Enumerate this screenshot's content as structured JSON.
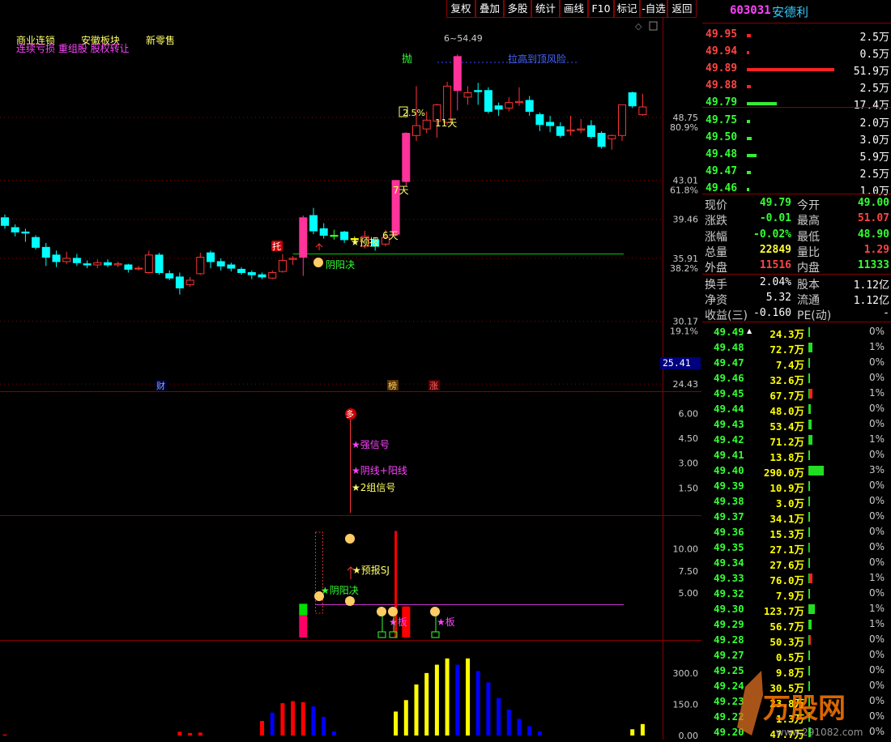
{
  "toolbar": {
    "buttons": [
      "复权",
      "叠加",
      "多股",
      "统计",
      "画线",
      "F10",
      "标记",
      "-自选",
      "返回"
    ]
  },
  "header": {
    "code": "603031",
    "name": "安德利"
  },
  "chart_tags": {
    "line1": [
      "商业连锁",
      "安徽板块",
      "新零售"
    ],
    "line2": "连续亏损 重组股 股权转让"
  },
  "price_axis": {
    "labels": [
      {
        "v": "48.75",
        "p": "80.9%"
      },
      {
        "v": "43.01",
        "p": "61.8%"
      },
      {
        "v": "39.46",
        "p": ""
      },
      {
        "v": "35.91",
        "p": "38.2%"
      },
      {
        "v": "30.17",
        "p": "19.1%"
      },
      {
        "v": "24.43",
        "p": ""
      }
    ],
    "current_box": "25.41"
  },
  "main_annotations": {
    "high": "6~54.49",
    "sell": "抛",
    "risk": "拉高到顶风险",
    "pct": "2.5%",
    "days11": "11天",
    "days7": "7天",
    "days6": "6天",
    "tuo": "托",
    "forecast": "★预报",
    "yinyang": "阴阳决",
    "cai": "财",
    "bang": "榜",
    "zhang": "涨"
  },
  "panel2": {
    "axis": [
      "6.00",
      "4.50",
      "3.00",
      "1.50"
    ],
    "duo": "多",
    "signals": [
      "★强信号",
      "★阴线+阳线",
      "★2组信号"
    ]
  },
  "panel3": {
    "axis": [
      "10.00",
      "7.50",
      "5.00"
    ],
    "labels": [
      "★预报SJ",
      "★阴阳决",
      "★板",
      "★板"
    ]
  },
  "panel4": {
    "axis": [
      "300.0",
      "150.0",
      "0.00"
    ]
  },
  "order_book": {
    "asks": [
      {
        "price": "49.95",
        "vol": "2.5万",
        "bar": 0.05
      },
      {
        "price": "49.94",
        "vol": "0.5万",
        "bar": 0.01
      },
      {
        "price": "49.89",
        "vol": "51.9万",
        "bar": 1.0
      },
      {
        "price": "49.88",
        "vol": "2.5万",
        "bar": 0.05
      },
      {
        "price": "49.79",
        "vol": "17.4万",
        "bar": 0.34
      }
    ],
    "bids": [
      {
        "price": "49.75",
        "vol": "2.0万",
        "bar": 0.04
      },
      {
        "price": "49.50",
        "vol": "3.0万",
        "bar": 0.06
      },
      {
        "price": "49.48",
        "vol": "5.9万",
        "bar": 0.11
      },
      {
        "price": "49.47",
        "vol": "2.5万",
        "bar": 0.05
      },
      {
        "price": "49.46",
        "vol": "1.0万",
        "bar": 0.02
      }
    ]
  },
  "stats": [
    {
      "l1": "现价",
      "v1": "49.79",
      "c1": "#33ff33",
      "l2": "今开",
      "v2": "49.00",
      "c2": "#33ff33"
    },
    {
      "l1": "涨跌",
      "v1": "-0.01",
      "c1": "#33ff33",
      "l2": "最高",
      "v2": "51.07",
      "c2": "#ff4444"
    },
    {
      "l1": "涨幅",
      "v1": "-0.02%",
      "c1": "#33ff33",
      "l2": "最低",
      "v2": "48.90",
      "c2": "#33ff33"
    },
    {
      "l1": "总量",
      "v1": "22849",
      "c1": "#ffff33",
      "l2": "量比",
      "v2": "1.29",
      "c2": "#ff4444"
    },
    {
      "l1": "外盘",
      "v1": "11516",
      "c1": "#ff4444",
      "l2": "内盘",
      "v2": "11333",
      "c2": "#33ff33"
    }
  ],
  "fundamentals": [
    {
      "l1": "换手",
      "v1": "2.04%",
      "l2": "股本",
      "v2": "1.12亿"
    },
    {
      "l1": "净资",
      "v1": "5.32",
      "l2": "流通",
      "v2": "1.12亿"
    },
    {
      "l1": "收益(三)",
      "v1": "-0.160",
      "l2": "PE(动)",
      "v2": "-"
    }
  ],
  "price_volume": [
    {
      "price": "49.49",
      "vol": "24.3万",
      "pct": "0%",
      "bar": 0.02,
      "col": "g",
      "arrow": true
    },
    {
      "price": "49.48",
      "vol": "72.7万",
      "pct": "1%",
      "bar": 0.06,
      "col": "g"
    },
    {
      "price": "49.47",
      "vol": "7.4万",
      "pct": "0%",
      "bar": 0.01,
      "col": "g"
    },
    {
      "price": "49.46",
      "vol": "32.6万",
      "pct": "0%",
      "bar": 0.03,
      "col": "g"
    },
    {
      "price": "49.45",
      "vol": "67.7万",
      "pct": "1%",
      "bar": 0.06,
      "col": "r"
    },
    {
      "price": "49.44",
      "vol": "48.0万",
      "pct": "0%",
      "bar": 0.04,
      "col": "g"
    },
    {
      "price": "49.43",
      "vol": "53.4万",
      "pct": "0%",
      "bar": 0.05,
      "col": "g"
    },
    {
      "price": "49.42",
      "vol": "71.2万",
      "pct": "1%",
      "bar": 0.06,
      "col": "g"
    },
    {
      "price": "49.41",
      "vol": "13.8万",
      "pct": "0%",
      "bar": 0.01,
      "col": "g"
    },
    {
      "price": "49.40",
      "vol": "290.0万",
      "pct": "3%",
      "bar": 0.24,
      "col": "g"
    },
    {
      "price": "49.39",
      "vol": "10.9万",
      "pct": "0%",
      "bar": 0.01,
      "col": "g"
    },
    {
      "price": "49.38",
      "vol": "3.0万",
      "pct": "0%",
      "bar": 0.0,
      "col": "g"
    },
    {
      "price": "49.37",
      "vol": "34.1万",
      "pct": "0%",
      "bar": 0.03,
      "col": "g"
    },
    {
      "price": "49.36",
      "vol": "15.3万",
      "pct": "0%",
      "bar": 0.01,
      "col": "g"
    },
    {
      "price": "49.35",
      "vol": "27.1万",
      "pct": "0%",
      "bar": 0.02,
      "col": "r"
    },
    {
      "price": "49.34",
      "vol": "27.6万",
      "pct": "0%",
      "bar": 0.02,
      "col": "g"
    },
    {
      "price": "49.33",
      "vol": "76.0万",
      "pct": "1%",
      "bar": 0.06,
      "col": "r"
    },
    {
      "price": "49.32",
      "vol": "7.9万",
      "pct": "0%",
      "bar": 0.01,
      "col": "g"
    },
    {
      "price": "49.30",
      "vol": "123.7万",
      "pct": "1%",
      "bar": 0.1,
      "col": "g"
    },
    {
      "price": "49.29",
      "vol": "56.7万",
      "pct": "1%",
      "bar": 0.05,
      "col": "g"
    },
    {
      "price": "49.28",
      "vol": "50.3万",
      "pct": "0%",
      "bar": 0.04,
      "col": "r"
    },
    {
      "price": "49.27",
      "vol": "0.5万",
      "pct": "0%",
      "bar": 0.0,
      "col": "g"
    },
    {
      "price": "49.25",
      "vol": "9.8万",
      "pct": "0%",
      "bar": 0.01,
      "col": "g"
    },
    {
      "price": "49.24",
      "vol": "30.5万",
      "pct": "0%",
      "bar": 0.03,
      "col": "g"
    },
    {
      "price": "49.23",
      "vol": "23.8万",
      "pct": "0%",
      "bar": 0.02,
      "col": "g"
    },
    {
      "price": "49.22",
      "vol": "1.3万",
      "pct": "0%",
      "bar": 0.0,
      "col": "g"
    },
    {
      "price": "49.20",
      "vol": "47.7万",
      "pct": "0%",
      "bar": 0.04,
      "col": "g"
    }
  ],
  "watermark": {
    "text": "万股网",
    "url": "www.291082.com"
  },
  "chart_data": {
    "type": "candlestick",
    "candles": [
      {
        "o": 39.6,
        "c": 38.9,
        "h": 39.9,
        "l": 38.6
      },
      {
        "o": 38.7,
        "c": 38.3,
        "h": 39.0,
        "l": 37.9
      },
      {
        "o": 38.3,
        "c": 38.2,
        "h": 38.6,
        "l": 37.4
      },
      {
        "o": 37.8,
        "c": 36.9,
        "h": 38.0,
        "l": 36.7
      },
      {
        "o": 36.9,
        "c": 36.0,
        "h": 37.3,
        "l": 35.2
      },
      {
        "o": 36.2,
        "c": 35.6,
        "h": 36.6,
        "l": 35.1
      },
      {
        "o": 35.6,
        "c": 35.9,
        "h": 36.5,
        "l": 35.4
      },
      {
        "o": 35.9,
        "c": 35.5,
        "h": 36.3,
        "l": 35.2
      },
      {
        "o": 35.4,
        "c": 35.3,
        "h": 35.7,
        "l": 35.0
      },
      {
        "o": 35.3,
        "c": 35.5,
        "h": 35.8,
        "l": 35.0
      },
      {
        "o": 35.5,
        "c": 35.3,
        "h": 35.8,
        "l": 35.1
      },
      {
        "o": 35.3,
        "c": 35.4,
        "h": 35.6,
        "l": 35.1
      },
      {
        "o": 35.3,
        "c": 34.9,
        "h": 35.4,
        "l": 34.6
      },
      {
        "o": 35.0,
        "c": 35.0,
        "h": 35.2,
        "l": 34.8
      },
      {
        "o": 34.6,
        "c": 36.2,
        "h": 36.6,
        "l": 34.5
      },
      {
        "o": 36.2,
        "c": 34.6,
        "h": 36.4,
        "l": 34.4
      },
      {
        "o": 34.5,
        "c": 34.1,
        "h": 34.8,
        "l": 33.9
      },
      {
        "o": 34.2,
        "c": 33.2,
        "h": 34.6,
        "l": 32.6
      },
      {
        "o": 33.5,
        "c": 33.9,
        "h": 34.2,
        "l": 33.3
      },
      {
        "o": 34.5,
        "c": 36.0,
        "h": 36.4,
        "l": 34.4
      },
      {
        "o": 36.4,
        "c": 35.6,
        "h": 36.6,
        "l": 35.0
      },
      {
        "o": 35.6,
        "c": 35.2,
        "h": 35.9,
        "l": 34.8
      },
      {
        "o": 35.3,
        "c": 35.0,
        "h": 35.5,
        "l": 34.7
      },
      {
        "o": 34.9,
        "c": 34.6,
        "h": 35.1,
        "l": 34.4
      },
      {
        "o": 34.6,
        "c": 34.4,
        "h": 34.8,
        "l": 34.0
      },
      {
        "o": 34.4,
        "c": 34.2,
        "h": 34.6,
        "l": 34.0
      },
      {
        "o": 34.1,
        "c": 34.6,
        "h": 34.8,
        "l": 34.0
      },
      {
        "o": 34.7,
        "c": 35.7,
        "h": 36.3,
        "l": 34.6
      },
      {
        "o": 35.8,
        "c": 35.9,
        "h": 36.1,
        "l": 35.3
      },
      {
        "o": 36.0,
        "c": 39.6,
        "h": 39.8,
        "l": 34.3
      },
      {
        "o": 39.8,
        "c": 38.4,
        "h": 40.5,
        "l": 38.1
      },
      {
        "o": 38.6,
        "c": 38.0,
        "h": 39.1,
        "l": 37.7
      },
      {
        "o": 38.0,
        "c": 37.9,
        "h": 38.5,
        "l": 37.6
      },
      {
        "o": 38.3,
        "c": 37.6,
        "h": 38.4,
        "l": 37.3
      },
      {
        "o": 37.7,
        "c": 37.6,
        "h": 37.9,
        "l": 37.3
      },
      {
        "o": 37.0,
        "c": 37.9,
        "h": 38.4,
        "l": 36.8
      },
      {
        "o": 37.6,
        "c": 37.0,
        "h": 37.8,
        "l": 36.6
      },
      {
        "o": 37.2,
        "c": 37.8,
        "h": 38.5,
        "l": 37.0
      },
      {
        "o": 38.1,
        "c": 43.0,
        "h": 43.0,
        "l": 37.9
      },
      {
        "o": 42.9,
        "c": 47.3,
        "h": 47.4,
        "l": 42.5
      },
      {
        "o": 47.1,
        "c": 48.0,
        "h": 51.6,
        "l": 46.6
      },
      {
        "o": 47.7,
        "c": 48.5,
        "h": 49.3,
        "l": 47.3
      },
      {
        "o": 48.4,
        "c": 49.9,
        "h": 50.0,
        "l": 46.9
      },
      {
        "o": 48.3,
        "c": 51.6,
        "h": 52.0,
        "l": 48.1
      },
      {
        "o": 51.2,
        "c": 54.3,
        "h": 54.5,
        "l": 49.4
      },
      {
        "o": 50.6,
        "c": 51.0,
        "h": 51.6,
        "l": 49.9
      },
      {
        "o": 51.2,
        "c": 51.1,
        "h": 51.9,
        "l": 49.9
      },
      {
        "o": 51.2,
        "c": 49.3,
        "h": 51.5,
        "l": 49.1
      },
      {
        "o": 49.8,
        "c": 49.5,
        "h": 50.1,
        "l": 48.9
      },
      {
        "o": 49.6,
        "c": 50.1,
        "h": 50.6,
        "l": 49.3
      },
      {
        "o": 50.1,
        "c": 50.2,
        "h": 51.5,
        "l": 49.8
      },
      {
        "o": 50.3,
        "c": 49.3,
        "h": 50.7,
        "l": 48.9
      },
      {
        "o": 49.0,
        "c": 48.1,
        "h": 49.2,
        "l": 47.5
      },
      {
        "o": 48.3,
        "c": 48.0,
        "h": 48.9,
        "l": 47.4
      },
      {
        "o": 47.9,
        "c": 47.1,
        "h": 48.3,
        "l": 46.9
      },
      {
        "o": 47.5,
        "c": 47.6,
        "h": 48.9,
        "l": 47.1
      },
      {
        "o": 47.6,
        "c": 47.7,
        "h": 48.6,
        "l": 47.3
      },
      {
        "o": 48.0,
        "c": 47.0,
        "h": 48.5,
        "l": 46.8
      },
      {
        "o": 47.3,
        "c": 46.1,
        "h": 47.5,
        "l": 45.9
      },
      {
        "o": 46.8,
        "c": 47.1,
        "h": 47.2,
        "l": 45.8
      },
      {
        "o": 47.1,
        "c": 49.9,
        "h": 49.9,
        "l": 46.6
      },
      {
        "o": 51.0,
        "c": 49.8,
        "h": 51.1,
        "l": 49.6
      },
      {
        "o": 49.0,
        "c": 49.7,
        "h": 50.9,
        "l": 48.9
      }
    ],
    "ylim": [
      24.0,
      56.5
    ],
    "support_line": 36.3,
    "mid_volume": [
      {
        "i": 29,
        "v": 2.5,
        "col": "#ff0066"
      },
      {
        "i": 29,
        "v": 1.3,
        "col": "#00e000"
      },
      {
        "i": 38,
        "v": 12.0,
        "col": "#ff0000"
      },
      {
        "i": 39,
        "v": 3.5,
        "col": "#ff0000"
      }
    ],
    "bottom_volume": [
      {
        "i": 0,
        "v": 5,
        "col": "#ff0000"
      },
      {
        "i": 17,
        "v": 18,
        "col": "#ff0000"
      },
      {
        "i": 18,
        "v": 12,
        "col": "#ff0000"
      },
      {
        "i": 19,
        "v": 14,
        "col": "#ff0000"
      },
      {
        "i": 25,
        "v": 70,
        "col": "#ff0000"
      },
      {
        "i": 26,
        "v": 110,
        "col": "#0000ff"
      },
      {
        "i": 27,
        "v": 155,
        "col": "#ff0000"
      },
      {
        "i": 28,
        "v": 165,
        "col": "#ff0000"
      },
      {
        "i": 29,
        "v": 160,
        "col": "#ff0000"
      },
      {
        "i": 30,
        "v": 140,
        "col": "#0000ff"
      },
      {
        "i": 31,
        "v": 90,
        "col": "#0000ff"
      },
      {
        "i": 32,
        "v": 20,
        "col": "#0000ff"
      },
      {
        "i": 38,
        "v": 115,
        "col": "#ffff00"
      },
      {
        "i": 39,
        "v": 170,
        "col": "#ffff00"
      },
      {
        "i": 40,
        "v": 245,
        "col": "#ffff00"
      },
      {
        "i": 41,
        "v": 300,
        "col": "#ffff00"
      },
      {
        "i": 42,
        "v": 340,
        "col": "#ffff00"
      },
      {
        "i": 43,
        "v": 370,
        "col": "#ffff00"
      },
      {
        "i": 44,
        "v": 340,
        "col": "#0000ff"
      },
      {
        "i": 45,
        "v": 370,
        "col": "#ffff00"
      },
      {
        "i": 46,
        "v": 310,
        "col": "#0000ff"
      },
      {
        "i": 47,
        "v": 255,
        "col": "#0000ff"
      },
      {
        "i": 48,
        "v": 180,
        "col": "#0000ff"
      },
      {
        "i": 49,
        "v": 125,
        "col": "#0000ff"
      },
      {
        "i": 50,
        "v": 80,
        "col": "#0000ff"
      },
      {
        "i": 51,
        "v": 45,
        "col": "#0000ff"
      },
      {
        "i": 52,
        "v": 20,
        "col": "#0000ff"
      },
      {
        "i": 61,
        "v": 30,
        "col": "#ffff00"
      },
      {
        "i": 62,
        "v": 55,
        "col": "#ffff00"
      }
    ]
  }
}
